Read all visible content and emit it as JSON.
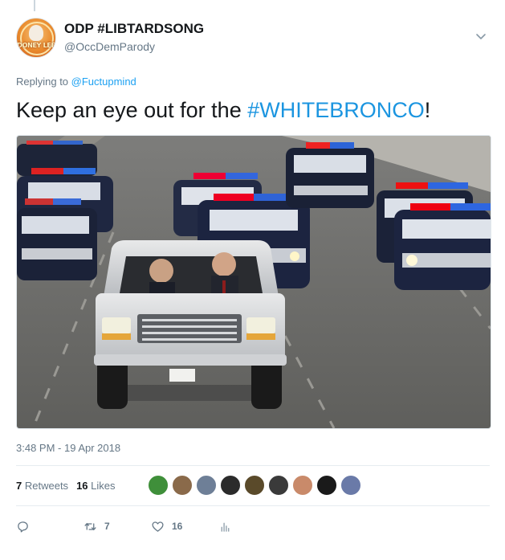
{
  "tweet": {
    "display_name": "ODP #LIBTARDSONG",
    "handle": "@OccDemParody",
    "avatar_label": "DONEY LEE",
    "replying_prefix": "Replying to ",
    "replying_to": "@Fuctupmind",
    "text_before": "Keep an eye out for the ",
    "hashtag": "#WHITEBRONCO",
    "text_after": "!",
    "timestamp": "3:48 PM - 19 Apr 2018"
  },
  "stats": {
    "retweets_count": "7",
    "retweets_label": "Retweets",
    "likes_count": "16",
    "likes_label": "Likes"
  },
  "likers": [
    {
      "name": "liker-avatar-1",
      "color": "#3f8f3a"
    },
    {
      "name": "liker-avatar-2",
      "color": "#8a6a4a"
    },
    {
      "name": "liker-avatar-3",
      "color": "#6e7f97"
    },
    {
      "name": "liker-avatar-4",
      "color": "#2b2b2b"
    },
    {
      "name": "liker-avatar-5",
      "color": "#5a4a2a"
    },
    {
      "name": "liker-avatar-6",
      "color": "#3a3a3a"
    },
    {
      "name": "liker-avatar-7",
      "color": "#c98a6a"
    },
    {
      "name": "liker-avatar-8",
      "color": "#1a1a1a"
    },
    {
      "name": "liker-avatar-9",
      "color": "#6a7aa8"
    }
  ],
  "actions": {
    "reply_icon": "reply-icon",
    "retweet_icon": "retweet-icon",
    "retweet_count": "7",
    "like_icon": "heart-icon",
    "like_count": "16",
    "analytics_icon": "analytics-icon"
  },
  "colors": {
    "link": "#1da1f2",
    "hashtag": "#1b95e0",
    "secondary_text": "#657786",
    "primary_text": "#14171a"
  }
}
